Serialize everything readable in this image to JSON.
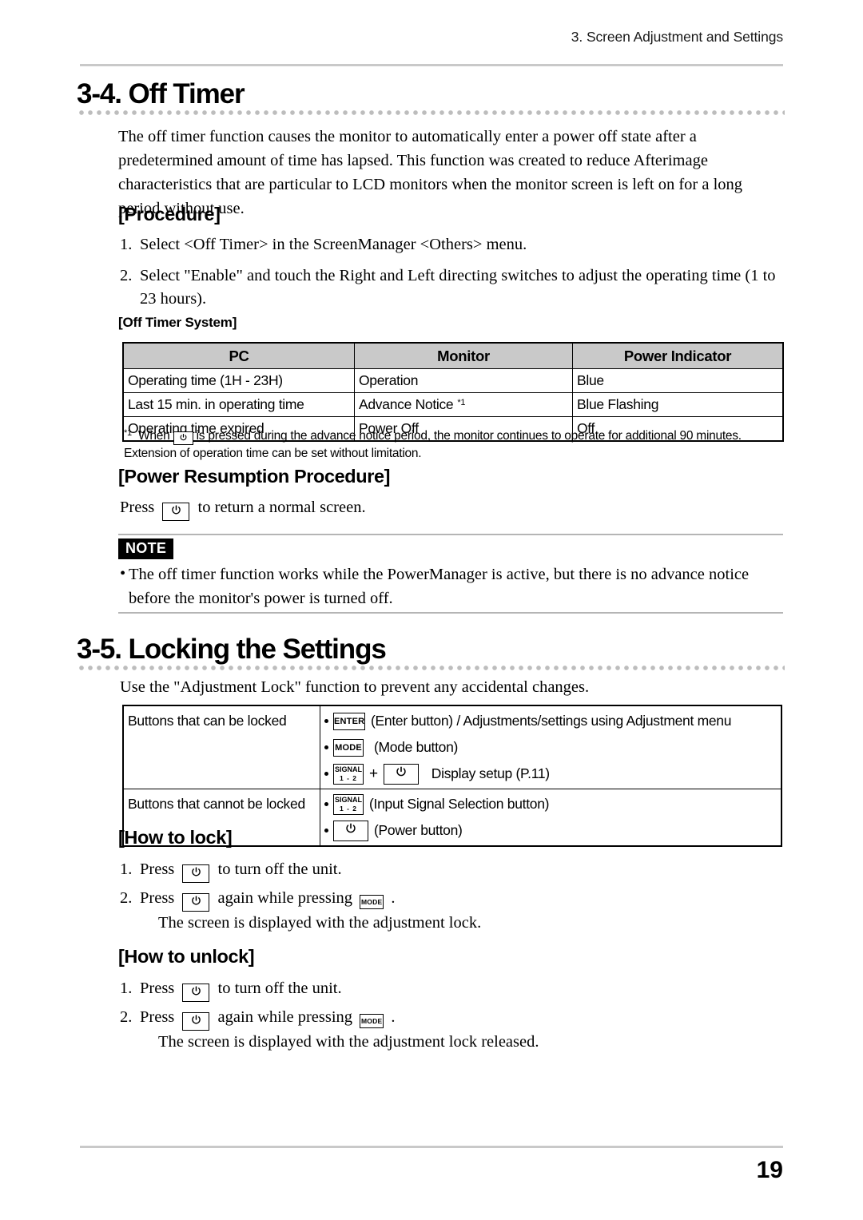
{
  "header": {
    "running_head": "3. Screen Adjustment and Settings"
  },
  "sections": [
    {
      "number_title": "3-4. Off Timer",
      "intro": "The off timer function causes the monitor to automatically enter a power off state after a predetermined amount of time has lapsed. This function was created to reduce Afterimage characteristics that are particular to LCD monitors when the monitor screen is left on for a long period without use.",
      "procedure_heading": "[Procedure]",
      "procedure_steps": [
        {
          "num": "1.",
          "text": "Select <Off Timer> in the ScreenManager <Others> menu."
        },
        {
          "num": "2.",
          "text": "Select \"Enable\" and touch the Right and Left directing switches to adjust the operating time (1 to 23 hours)."
        }
      ],
      "table_caption": "[Off Timer System]",
      "table": {
        "headers": [
          "PC",
          "Monitor",
          "Power Indicator"
        ],
        "rows": [
          [
            "Operating time (1H - 23H)",
            "Operation",
            "Blue"
          ],
          [
            "Last 15 min. in operating time",
            "Advance Notice",
            "Blue Flashing"
          ],
          [
            "Operating time expired",
            "Power Off",
            "Off"
          ]
        ],
        "row_1_monitor_footnote_mark": "*1"
      },
      "footnote": {
        "mark": "*1",
        "before_icon": "When",
        "icon": "power-button-icon",
        "after_icon": "is pressed during the advance notice period, the monitor continues to operate for additional 90 minutes. Extension of operation time can be set without limitation."
      },
      "resumption_heading": "[Power Resumption Procedure]",
      "resumption_before": "Press",
      "resumption_icon": "power-button-icon",
      "resumption_after": "to return a normal screen.",
      "note_badge": "NOTE",
      "note_bullet_mark": "•",
      "note_text": "The off timer function works while the PowerManager is active, but there is no advance notice before the monitor's power is turned off."
    },
    {
      "number_title": "3-5. Locking the Settings",
      "intro": "Use the \"Adjustment Lock\" function to prevent any accidental changes.",
      "lock_table": {
        "rows": [
          {
            "label": "Buttons that can be locked",
            "items": [
              {
                "keys": [
                  "ENTER"
                ],
                "text": "(Enter button) / Adjustments/settings using Adjustment menu"
              },
              {
                "keys": [
                  "MODE"
                ],
                "text": "(Mode button)"
              },
              {
                "keys": [
                  "SIGNAL",
                  "+",
                  "POWER"
                ],
                "text": "Display setup (P.11)"
              }
            ]
          },
          {
            "label": "Buttons that cannot be locked",
            "items": [
              {
                "keys": [
                  "SIGNAL"
                ],
                "text": "(Input Signal Selection button)"
              },
              {
                "keys": [
                  "POWER"
                ],
                "text": "(Power button)"
              }
            ]
          }
        ]
      },
      "how_to_lock_heading": "[How to lock]",
      "how_to_lock_steps": [
        {
          "num": "1.",
          "before": "Press",
          "icon": "power-button-icon",
          "after": "to turn off the unit."
        },
        {
          "num": "2.",
          "before": "Press",
          "icon": "power-button-icon",
          "middle": "again while pressing",
          "icon2": "mode-button-icon",
          "after": ".",
          "extra": "The screen is displayed with the adjustment lock."
        }
      ],
      "how_to_unlock_heading": "[How to unlock]",
      "how_to_unlock_steps": [
        {
          "num": "1.",
          "before": "Press",
          "icon": "power-button-icon",
          "after": "to turn off the unit."
        },
        {
          "num": "2.",
          "before": "Press",
          "icon": "power-button-icon",
          "middle": "again while pressing",
          "icon2": "mode-button-icon",
          "after": ".",
          "extra": "The screen is displayed with the adjustment lock released."
        }
      ]
    }
  ],
  "keys": {
    "enter_label": "ENTER",
    "mode_label": "MODE",
    "signal_line1": "SIGNAL",
    "signal_line2": "1 - 2",
    "power_glyph": "⏻",
    "plus": "+"
  },
  "footer": {
    "page_number": "19"
  },
  "colors": {
    "rule_gray": "#c9c9c9",
    "table_header_gray": "#c9c9c9",
    "text_black": "#000000",
    "dot_gray": "#bdbdbd"
  }
}
